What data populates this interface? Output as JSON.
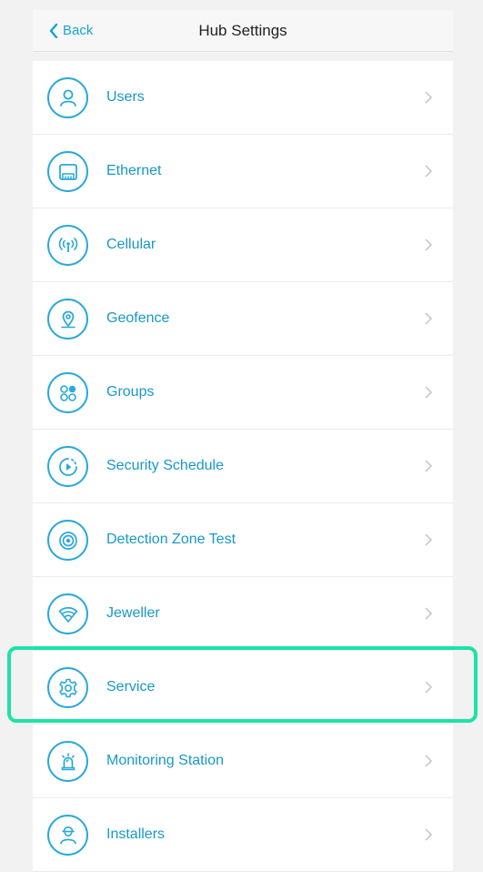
{
  "header": {
    "back_label": "Back",
    "title": "Hub Settings"
  },
  "colors": {
    "accent": "#1798c9",
    "icon_ring": "#29a9da",
    "highlight": "#1de3a6"
  },
  "items": [
    {
      "label": "Users",
      "icon": "user-icon"
    },
    {
      "label": "Ethernet",
      "icon": "ethernet-icon"
    },
    {
      "label": "Cellular",
      "icon": "cellular-antenna-icon"
    },
    {
      "label": "Geofence",
      "icon": "location-pin-icon"
    },
    {
      "label": "Groups",
      "icon": "groups-icon"
    },
    {
      "label": "Security Schedule",
      "icon": "play-clock-icon"
    },
    {
      "label": "Detection Zone Test",
      "icon": "target-icon"
    },
    {
      "label": "Jeweller",
      "icon": "wifi-icon"
    },
    {
      "label": "Service",
      "icon": "gear-icon"
    },
    {
      "label": "Monitoring Station",
      "icon": "siren-icon"
    },
    {
      "label": "Installers",
      "icon": "installer-icon"
    }
  ]
}
